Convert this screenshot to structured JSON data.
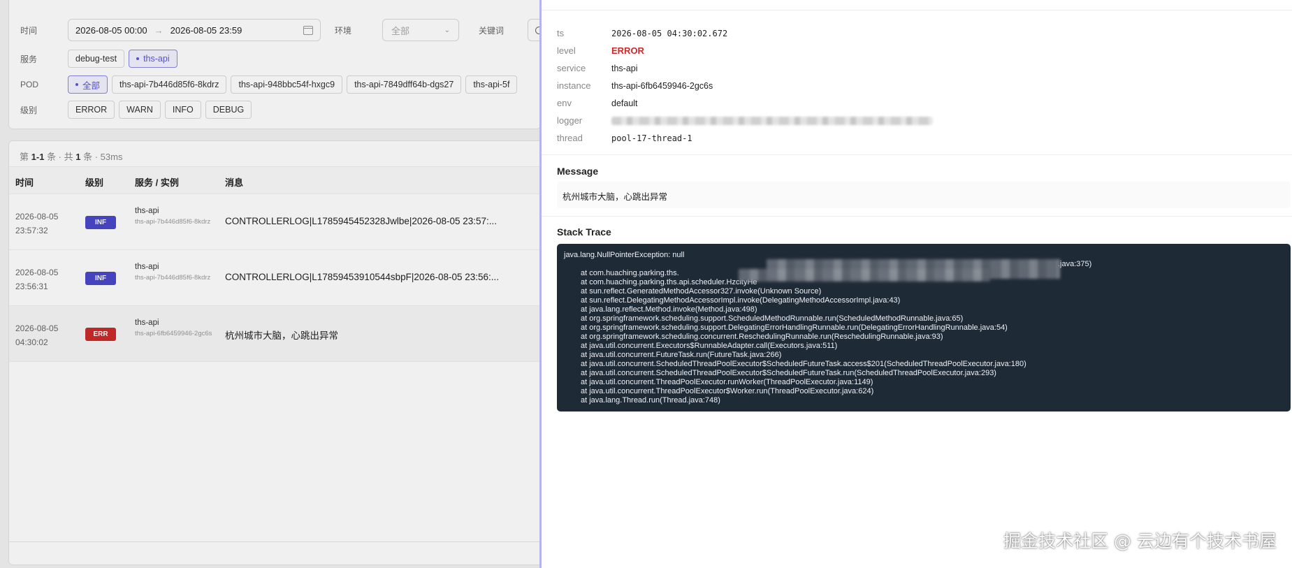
{
  "filters": {
    "time_label": "时间",
    "time_start": "2026-08-05 00:00",
    "time_arrow": "→",
    "time_end": "2026-08-05 23:59",
    "env_label": "环境",
    "env_value": "全部",
    "keyword_label": "关键词",
    "service_label": "服务",
    "services": [
      "debug-test",
      "ths-api"
    ],
    "pod_label": "POD",
    "pods": [
      "全部",
      "ths-api-7b446d85f6-8kdrz",
      "ths-api-948bbc54f-hxgc9",
      "ths-api-7849dff64b-dgs27",
      "ths-api-5f"
    ],
    "level_label": "级别",
    "levels": [
      "ERROR",
      "WARN",
      "INFO",
      "DEBUG"
    ]
  },
  "list": {
    "summary_prefix": "第",
    "summary_range": "1-1",
    "summary_mid": "条 · 共",
    "summary_total": "1",
    "summary_suffix": "条 · 53ms",
    "columns": [
      "时间",
      "级别",
      "服务 / 实例",
      "消息"
    ],
    "rows": [
      {
        "date": "2026-08-05",
        "time": "23:57:32",
        "level": "INF",
        "service": "ths-api",
        "instance": "ths-api-7b446d85f6-8kdrz",
        "message": "CONTROLLERLOG|L1785945452328Jwlbe|2026-08-05 23:57:..."
      },
      {
        "date": "2026-08-05",
        "time": "23:56:31",
        "level": "INF",
        "service": "ths-api",
        "instance": "ths-api-7b446d85f6-8kdrz",
        "message": "CONTROLLERLOG|L17859453910544sbpF|2026-08-05 23:56:..."
      },
      {
        "date": "2026-08-05",
        "time": "04:30:02",
        "level": "ERR",
        "service": "ths-api",
        "instance": "ths-api-6fb6459946-2gc6s",
        "message": "杭州城市大脑，心跳出异常"
      }
    ]
  },
  "detail": {
    "fields": {
      "ts_key": "ts",
      "ts": "2026-08-05 04:30:02.672",
      "level_key": "level",
      "level": "ERROR",
      "service_key": "service",
      "service": "ths-api",
      "instance_key": "instance",
      "instance": "ths-api-6fb6459946-2gc6s",
      "env_key": "env",
      "env": "default",
      "logger_key": "logger",
      "thread_key": "thread",
      "thread": "pool-17-thread-1"
    },
    "message_title": "Message",
    "message": "杭州城市大脑，心跳出异常",
    "stack_title": "Stack Trace",
    "stack_lines": [
      "java.lang.NullPointerException: null",
      ".java:375)",
      "at com.huaching.parking.ths.",
      "at com.huaching.parking.ths.api.scheduler.HzcityHe",
      "at sun.reflect.GeneratedMethodAccessor327.invoke(Unknown Source)",
      "at sun.reflect.DelegatingMethodAccessorImpl.invoke(DelegatingMethodAccessorImpl.java:43)",
      "at java.lang.reflect.Method.invoke(Method.java:498)",
      "at org.springframework.scheduling.support.ScheduledMethodRunnable.run(ScheduledMethodRunnable.java:65)",
      "at org.springframework.scheduling.support.DelegatingErrorHandlingRunnable.run(DelegatingErrorHandlingRunnable.java:54)",
      "at org.springframework.scheduling.concurrent.ReschedulingRunnable.run(ReschedulingRunnable.java:93)",
      "at java.util.concurrent.Executors$RunnableAdapter.call(Executors.java:511)",
      "at java.util.concurrent.FutureTask.run(FutureTask.java:266)",
      "at java.util.concurrent.ScheduledThreadPoolExecutor$ScheduledFutureTask.access$201(ScheduledThreadPoolExecutor.java:180)",
      "at java.util.concurrent.ScheduledThreadPoolExecutor$ScheduledFutureTask.run(ScheduledThreadPoolExecutor.java:293)",
      "at java.util.concurrent.ThreadPoolExecutor.runWorker(ThreadPoolExecutor.java:1149)",
      "at java.util.concurrent.ThreadPoolExecutor$Worker.run(ThreadPoolExecutor.java:624)",
      "at java.lang.Thread.run(Thread.java:748)"
    ]
  },
  "watermark": "掘金技术社区 @ 云边有个技术书屋",
  "colors": {
    "accent": "#5a57d6",
    "error": "#cc2a2a",
    "info_badge": "#4a48c9",
    "stack_bg": "#1f2a37"
  }
}
